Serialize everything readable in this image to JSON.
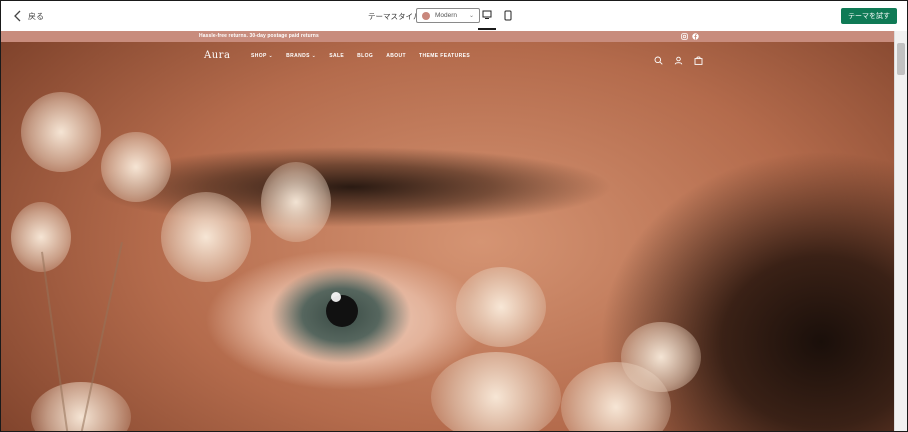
{
  "toolbar": {
    "back_label": "戻る",
    "theme_style_label": "テーマスタイル",
    "theme_style_value": "Modern",
    "theme_style_swatch": "#c9877c",
    "devices": [
      "desktop-icon",
      "mobile-icon"
    ],
    "try_button_label": "テーマを試す",
    "accent_color": "#0f7a55"
  },
  "store": {
    "announcement": "Hassle-free returns. 30-day postage paid returns",
    "announcement_color": "#c88c7d",
    "social_icons": [
      "instagram-icon",
      "facebook-icon"
    ],
    "logo": "Aura",
    "menu": [
      {
        "label": "SHOP ⌄"
      },
      {
        "label": "BRANDS ⌄"
      },
      {
        "label": "SALE"
      },
      {
        "label": "BLOG"
      },
      {
        "label": "ABOUT"
      },
      {
        "label": "THEME FEATURES"
      }
    ],
    "header_icons": [
      "search-icon",
      "account-icon",
      "cart-icon"
    ]
  }
}
